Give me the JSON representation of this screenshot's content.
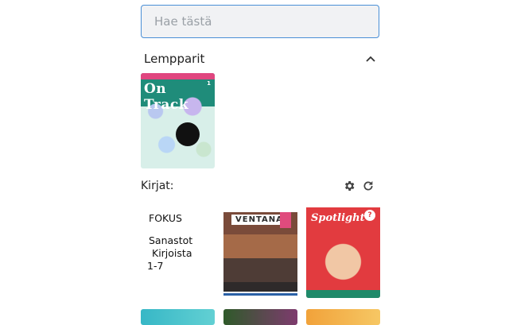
{
  "search": {
    "placeholder": "Hae tästä",
    "value": ""
  },
  "favorites": {
    "title": "Lempparit",
    "items": [
      {
        "title": "On Track",
        "badge": "1"
      }
    ]
  },
  "books": {
    "title": "Kirjat:",
    "items": [
      {
        "type": "text",
        "lines": [
          "FOKUS",
          "Sanastot",
          "Kirjoista",
          "1-7"
        ]
      },
      {
        "type": "cover",
        "title": "VENTANA"
      },
      {
        "type": "cover",
        "title": "Spotlight",
        "badge": "?"
      }
    ]
  },
  "colors": {
    "search_border": "#4a8fd6",
    "search_bg": "#f1f2f4",
    "icon": "#444444"
  },
  "icons": [
    "chevron-up-icon",
    "gear-icon",
    "refresh-icon"
  ]
}
